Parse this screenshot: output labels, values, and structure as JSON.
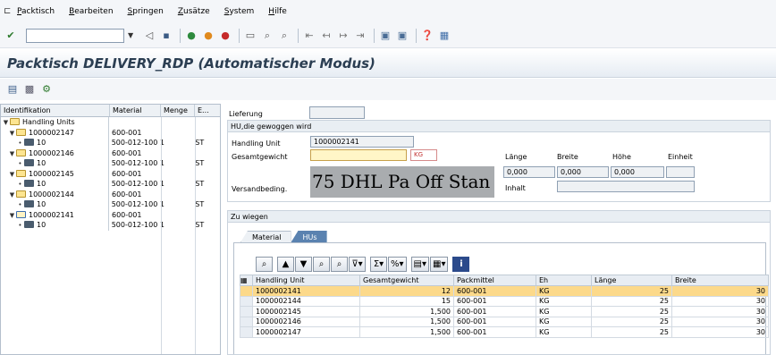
{
  "menu": [
    "Packtisch",
    "Bearbeiten",
    "Springen",
    "Zusätze",
    "System",
    "Hilfe"
  ],
  "title": "Packtisch DELIVERY_RDP (Automatischer Modus)",
  "tree": {
    "headers": [
      "Identifikation",
      "Material",
      "Menge",
      "E..."
    ],
    "rows": [
      {
        "id": "Handling Units",
        "material": "",
        "qty": "",
        "unit": ""
      },
      {
        "id": "1000002147",
        "material": "600-001",
        "qty": "",
        "unit": ""
      },
      {
        "id": "10",
        "material": "500-012-100 1",
        "qty": "",
        "unit": "ST"
      },
      {
        "id": "1000002146",
        "material": "600-001",
        "qty": "",
        "unit": ""
      },
      {
        "id": "10",
        "material": "500-012-100 1",
        "qty": "",
        "unit": "ST"
      },
      {
        "id": "1000002145",
        "material": "600-001",
        "qty": "",
        "unit": ""
      },
      {
        "id": "10",
        "material": "500-012-100 1",
        "qty": "",
        "unit": "ST"
      },
      {
        "id": "1000002144",
        "material": "600-001",
        "qty": "",
        "unit": ""
      },
      {
        "id": "10",
        "material": "500-012-100 1",
        "qty": "",
        "unit": "ST"
      },
      {
        "id": "1000002141",
        "material": "600-001",
        "qty": "",
        "unit": ""
      },
      {
        "id": "10",
        "material": "500-012-100 1",
        "qty": "",
        "unit": "ST"
      }
    ]
  },
  "lieferung": {
    "label": "Lieferung",
    "value": ""
  },
  "hu_group": {
    "title": "HU,die gewoggen wird",
    "hu_label": "Handling Unit",
    "hu_value": "1000002141",
    "gewicht_label": "Gesamtgewicht",
    "gewicht_value": "",
    "gewicht_unit": "KG",
    "versand_label": "Versandbeding.",
    "versand_value": "75 DHL Pa Off Stan",
    "dim_headers": [
      "Länge",
      "Breite",
      "Höhe",
      "Einheit"
    ],
    "dim_values": [
      "0,000",
      "0,000",
      "0,000",
      ""
    ],
    "inhalt_label": "Inhalt",
    "inhalt_value": ""
  },
  "zu_wiegen": {
    "title": "Zu wiegen",
    "tabs": [
      "Material",
      "HUs"
    ],
    "grid_headers": [
      "Handling Unit",
      "Gesamtgewicht",
      "Packmittel",
      "Eh",
      "Länge",
      "Breite"
    ],
    "grid_rows": [
      [
        "1000002141",
        "12",
        "600-001",
        "KG",
        "25",
        "30"
      ],
      [
        "1000002144",
        "15",
        "600-001",
        "KG",
        "25",
        "30"
      ],
      [
        "1000002145",
        "1,500",
        "600-001",
        "KG",
        "25",
        "30"
      ],
      [
        "1000002146",
        "1,500",
        "600-001",
        "KG",
        "25",
        "30"
      ],
      [
        "1000002147",
        "1,500",
        "600-001",
        "KG",
        "25",
        "30"
      ]
    ]
  },
  "colors": {
    "title": "#2b3e52",
    "highlight_row": "#fcd98a",
    "active_tab": "#5a82b0",
    "required_field": "#fff6c7"
  }
}
